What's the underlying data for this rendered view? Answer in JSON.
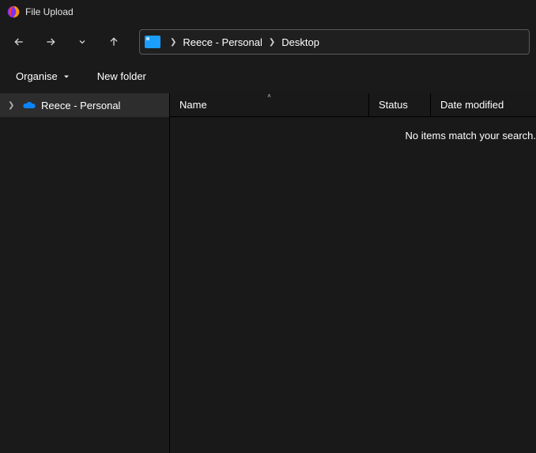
{
  "window": {
    "title": "File Upload"
  },
  "breadcrumb": {
    "parts": [
      "Reece - Personal",
      "Desktop"
    ]
  },
  "toolbar": {
    "organise_label": "Organise",
    "newfolder_label": "New folder"
  },
  "sidebar": {
    "items": [
      {
        "label": "Reece - Personal"
      }
    ]
  },
  "columns": {
    "name": "Name",
    "status": "Status",
    "date": "Date modified"
  },
  "content": {
    "empty_message": "No items match your search."
  }
}
